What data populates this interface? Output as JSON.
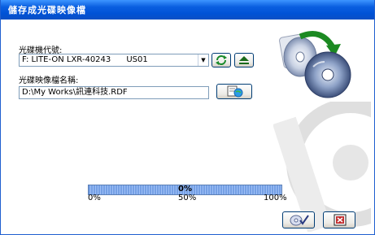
{
  "window": {
    "title": "儲存成光碟映像檔"
  },
  "drive": {
    "label": "光碟機代號:",
    "selected": "F: LITE-ON LXR-40243      US01"
  },
  "image_file": {
    "label": "光碟映像檔名稱:",
    "value": "D:\\My Works\\訊連科技.RDF"
  },
  "progress": {
    "value": 0,
    "percent_text": "0%",
    "tick_labels": [
      "0%",
      "50%",
      "100%"
    ]
  },
  "icons": {
    "refresh": "refresh-arrows-icon",
    "eject": "eject-icon",
    "browse": "browse-folder-icon",
    "disc_copy": "disc-copy-icon",
    "ok": "ok-disc-check-icon",
    "cancel": "cancel-icon"
  },
  "colors": {
    "title_bar": "#0a5fe0",
    "progress": "#5d8fe0"
  }
}
